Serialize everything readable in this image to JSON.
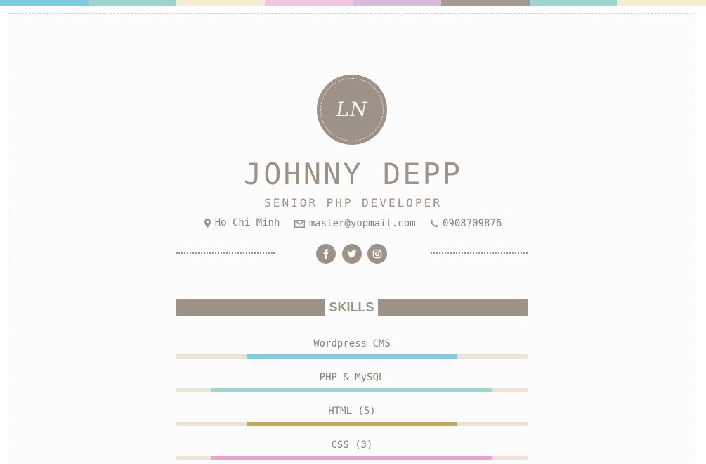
{
  "top_stripe": [
    "#7ecbe6",
    "#9fd3cf",
    "#f3edd2",
    "#f2c7dd",
    "#d9bbdc",
    "#a39b93",
    "#9fd3cf",
    "#f3edd2"
  ],
  "profile": {
    "monogram": "LN",
    "name": "JOHNNY DEPP",
    "title": "SENIOR PHP DEVELOPER",
    "location": "Ho Chi Minh",
    "email": "master@yopmail.com",
    "phone": "0908709876"
  },
  "social": [
    "facebook-icon",
    "twitter-icon",
    "instagram-icon"
  ],
  "skills": {
    "heading": "SKILLS",
    "items": [
      {
        "label": "Wordpress CMS",
        "level": 0.6,
        "color": "#7ecbe6"
      },
      {
        "label": "PHP & MySQL",
        "level": 0.8,
        "color": "#9fd3cf"
      },
      {
        "label": "HTML (5)",
        "level": 0.6,
        "color": "#c0a95c"
      },
      {
        "label": "CSS (3)",
        "level": 0.8,
        "color": "#e6a5cf"
      }
    ]
  },
  "colors": {
    "accent": "#9d9288",
    "text": "#8b8178",
    "track": "#ebe2d8"
  }
}
